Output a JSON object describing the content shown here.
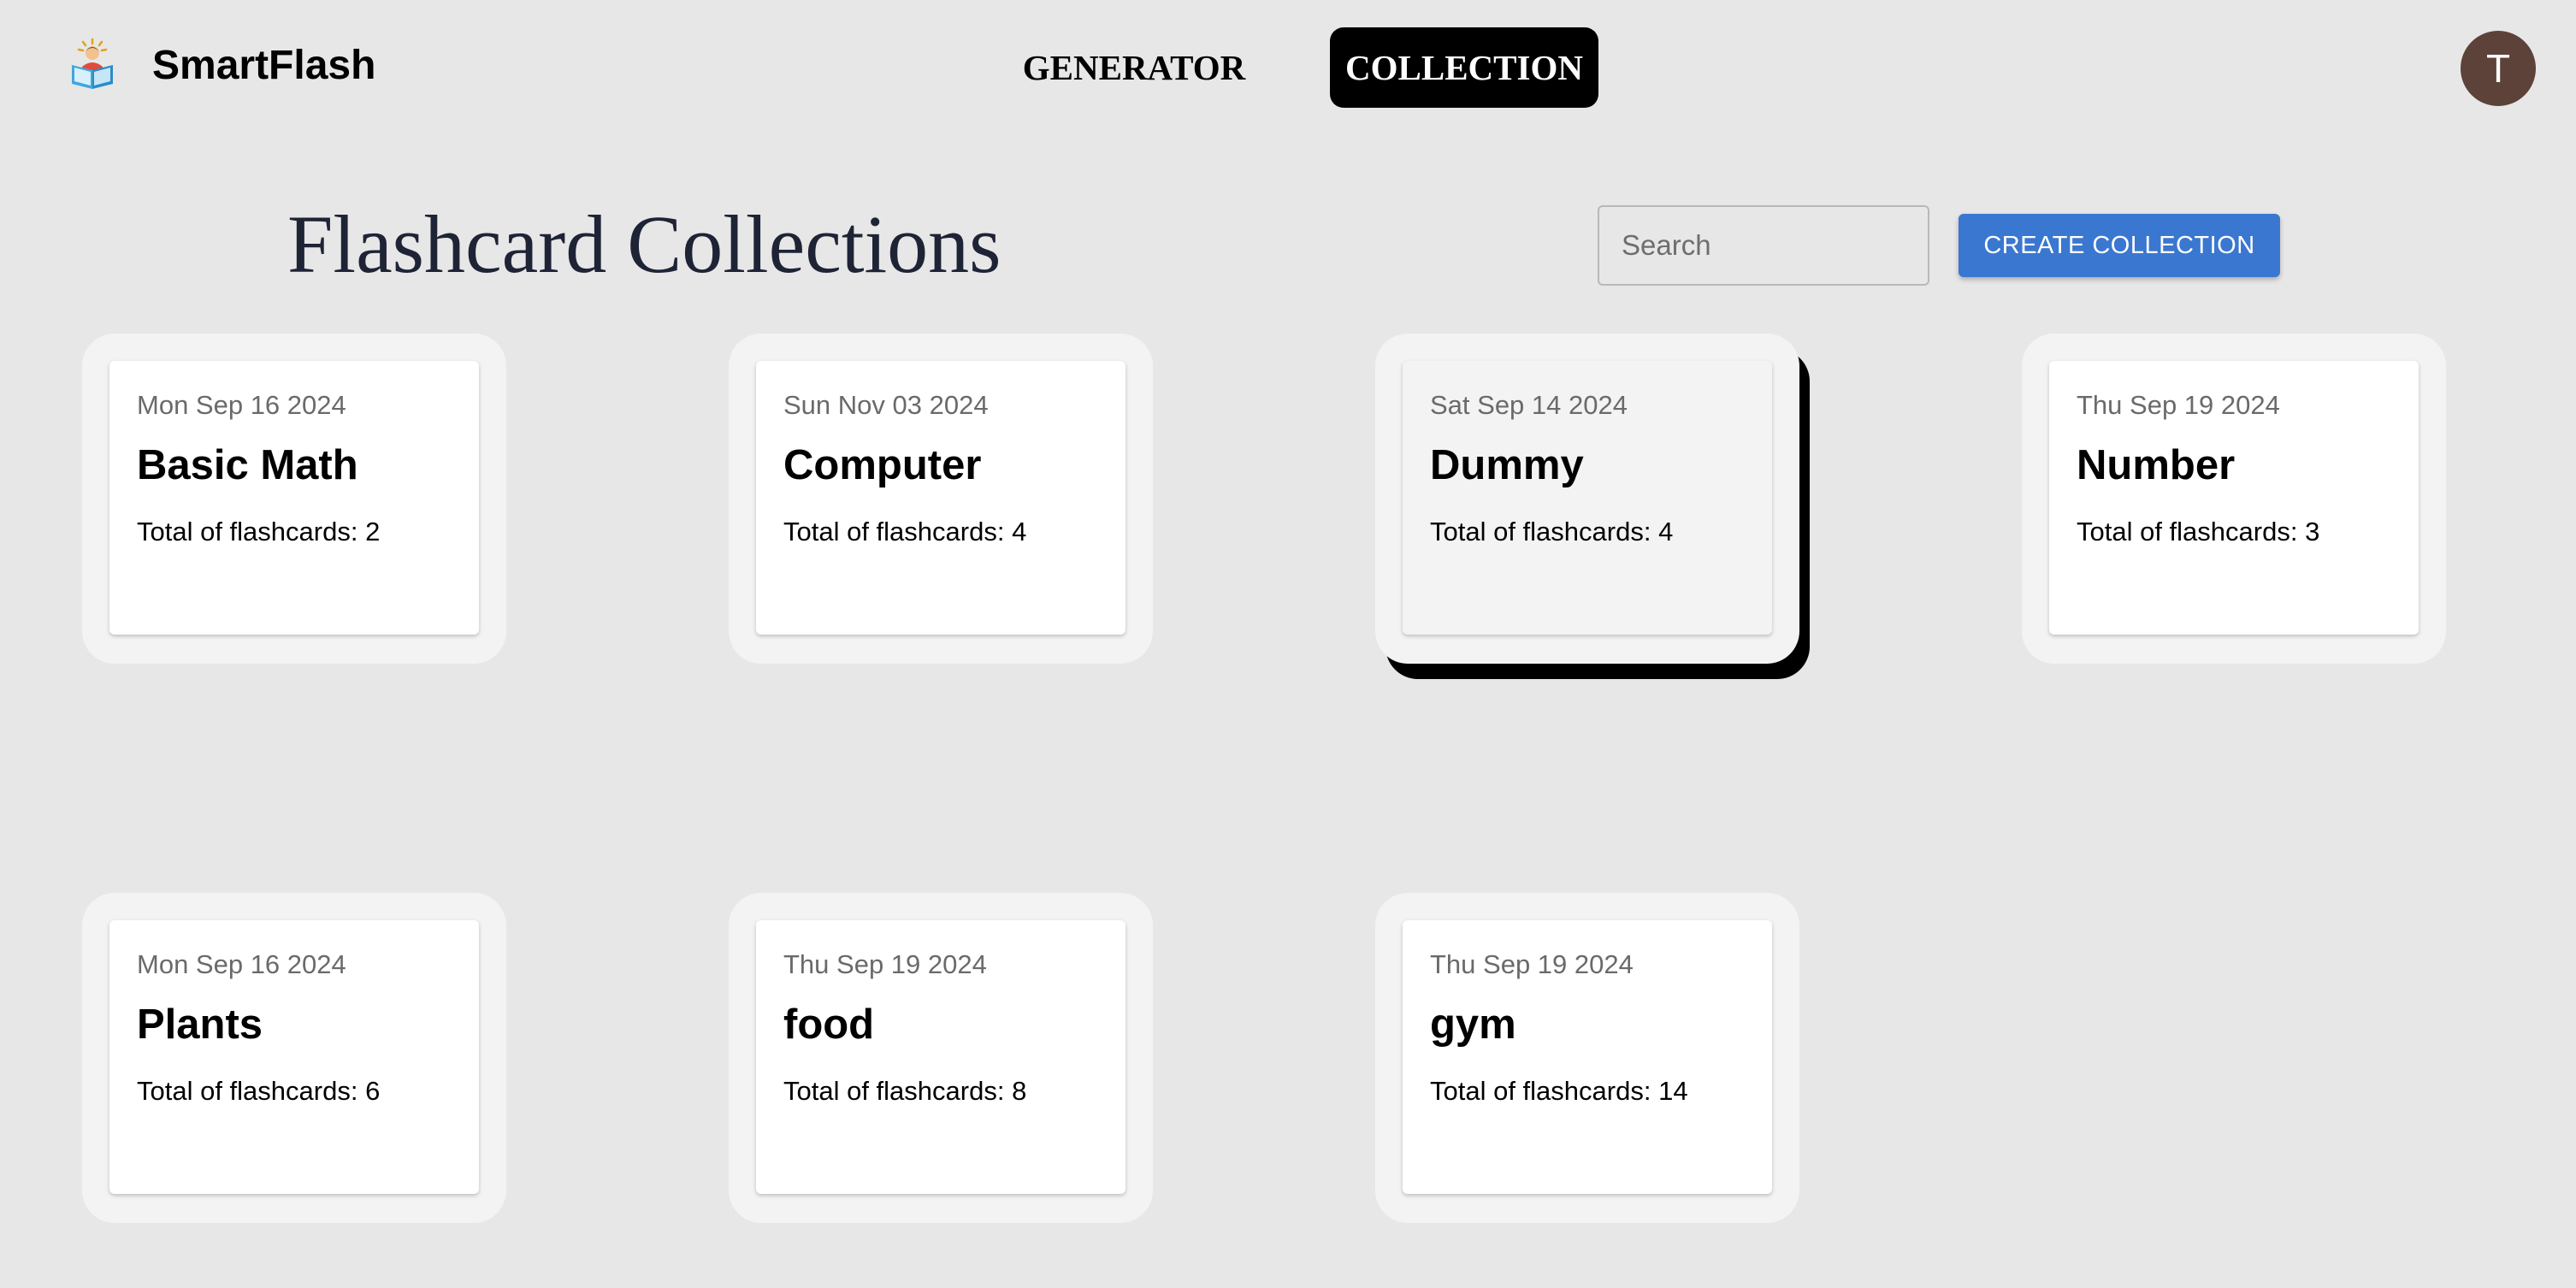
{
  "header": {
    "brand": "SmartFlash",
    "logo_icon": "reading-child-icon",
    "nav": [
      {
        "label": "GENERATOR",
        "active": false
      },
      {
        "label": "COLLECTION",
        "active": true
      }
    ],
    "avatar_initial": "T"
  },
  "main": {
    "title": "Flashcard Collections",
    "search": {
      "placeholder": "Search",
      "value": ""
    },
    "create_button_label": "CREATE COLLECTION",
    "accent_color": "#3a77d0"
  },
  "collections": [
    {
      "date": "Mon Sep 16 2024",
      "title": "Basic Math",
      "count_text": "Total of flashcards: 2"
    },
    {
      "date": "Sun Nov 03 2024",
      "title": "Computer",
      "count_text": "Total of flashcards: 4"
    },
    {
      "date": "Sat Sep 14 2024",
      "title": "Dummy",
      "count_text": "Total of flashcards: 4",
      "hovered": true
    },
    {
      "date": "Thu Sep 19 2024",
      "title": "Number",
      "count_text": "Total of flashcards: 3"
    },
    {
      "date": "Mon Sep 16 2024",
      "title": "Plants",
      "count_text": "Total of flashcards: 6"
    },
    {
      "date": "Thu Sep 19 2024",
      "title": "food",
      "count_text": "Total of flashcards: 8"
    },
    {
      "date": "Thu Sep 19 2024",
      "title": "gym",
      "count_text": "Total of flashcards: 14"
    }
  ]
}
